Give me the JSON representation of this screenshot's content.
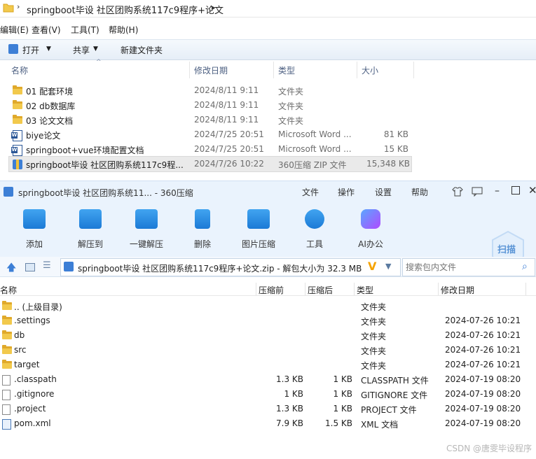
{
  "explorer": {
    "breadcrumb": "springboot毕设 社区团购系统117c9程序+论文",
    "menu": [
      "编辑(E)",
      "查看(V)",
      "工具(T)",
      "帮助(H)"
    ],
    "toolbar": {
      "open": "打开",
      "share": "共享",
      "new_folder": "新建文件夹"
    },
    "columns": {
      "name": "名称",
      "date": "修改日期",
      "type": "类型",
      "size": "大小"
    },
    "files": [
      {
        "name": "01 配套环境",
        "date": "2024/8/11 9:11",
        "type": "文件夹",
        "size": "",
        "icon": "folder-icon"
      },
      {
        "name": "02 db数据库",
        "date": "2024/8/11 9:11",
        "type": "文件夹",
        "size": "",
        "icon": "folder-icon"
      },
      {
        "name": "03 论文文档",
        "date": "2024/8/11 9:11",
        "type": "文件夹",
        "size": "",
        "icon": "folder-icon"
      },
      {
        "name": "biye论文",
        "date": "2024/7/25 20:51",
        "type": "Microsoft Word ...",
        "size": "81 KB",
        "icon": "word-icon"
      },
      {
        "name": "springboot+vue环境配置文档",
        "date": "2024/7/25 20:51",
        "type": "Microsoft Word ...",
        "size": "15 KB",
        "icon": "word-icon"
      },
      {
        "name": "springboot毕设 社区团购系统117c9程...",
        "date": "2024/7/26 10:22",
        "type": "360压缩 ZIP 文件",
        "size": "15,348 KB",
        "icon": "zip-icon"
      }
    ]
  },
  "zip": {
    "title": "springboot毕设 社区团购系统11... - 360压缩",
    "title_menu": [
      "文件",
      "操作",
      "设置",
      "帮助"
    ],
    "tools": [
      {
        "label": "添加",
        "icon": "add-icon"
      },
      {
        "label": "解压到",
        "icon": "extract-to-icon"
      },
      {
        "label": "一键解压",
        "icon": "one-click-extract-icon"
      },
      {
        "label": "删除",
        "icon": "delete-icon"
      },
      {
        "label": "图片压缩",
        "icon": "image-compress-icon"
      },
      {
        "label": "工具",
        "icon": "tools-icon"
      },
      {
        "label": "AI办公",
        "icon": "ai-office-icon"
      }
    ],
    "scan_label": "扫描",
    "path": "springboot毕设 社区团购系统117c9程序+论文.zip - 解包大小为 32.3 MB",
    "search_placeholder": "搜索包内文件",
    "columns": {
      "name": "名称",
      "before": "压缩前",
      "after": "压缩后",
      "type": "类型",
      "date": "修改日期"
    },
    "rows": [
      {
        "name": ".. (上级目录)",
        "before": "",
        "after": "",
        "type": "文件夹",
        "date": "",
        "icon": "folder-icon"
      },
      {
        "name": ".settings",
        "before": "",
        "after": "",
        "type": "文件夹",
        "date": "2024-07-26 10:21",
        "icon": "folder-icon"
      },
      {
        "name": "db",
        "before": "",
        "after": "",
        "type": "文件夹",
        "date": "2024-07-26 10:21",
        "icon": "folder-icon"
      },
      {
        "name": "src",
        "before": "",
        "after": "",
        "type": "文件夹",
        "date": "2024-07-26 10:21",
        "icon": "folder-icon"
      },
      {
        "name": "target",
        "before": "",
        "after": "",
        "type": "文件夹",
        "date": "2024-07-26 10:21",
        "icon": "folder-icon"
      },
      {
        "name": ".classpath",
        "before": "1.3 KB",
        "after": "1 KB",
        "type": "CLASSPATH 文件",
        "date": "2024-07-19 08:20",
        "icon": "file-icon"
      },
      {
        "name": ".gitignore",
        "before": "1 KB",
        "after": "1 KB",
        "type": "GITIGNORE 文件",
        "date": "2024-07-19 08:20",
        "icon": "file-icon"
      },
      {
        "name": ".project",
        "before": "1.3 KB",
        "after": "1 KB",
        "type": "PROJECT 文件",
        "date": "2024-07-19 08:20",
        "icon": "file-icon"
      },
      {
        "name": "pom.xml",
        "before": "7.9 KB",
        "after": "1.5 KB",
        "type": "XML 文档",
        "date": "2024-07-19 08:20",
        "icon": "xml-file-icon"
      }
    ]
  },
  "watermark": "CSDN @唐雯毕设程序"
}
